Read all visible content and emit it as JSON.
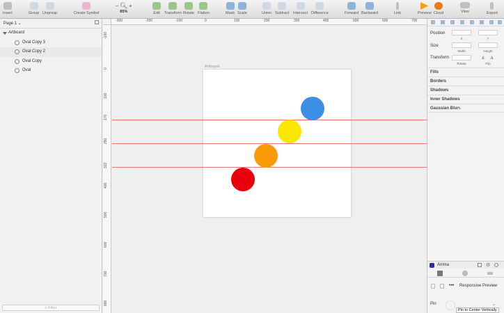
{
  "toolbar": {
    "insert": "Insert",
    "group": "Group",
    "ungroup": "Ungroup",
    "create_symbol": "Create Symbol",
    "zoom_minus": "–",
    "zoom_value": "85%",
    "zoom_plus": "+",
    "edit": "Edit",
    "transform": "Transform",
    "rotate": "Rotate",
    "flatten": "Flatten",
    "mask": "Mask",
    "scale": "Scale",
    "union": "Union",
    "subtract": "Subtract",
    "intersect": "Intersect",
    "difference": "Difference",
    "forward": "Forward",
    "backward": "Backward",
    "link": "Link",
    "preview": "Preview",
    "cloud": "Cloud",
    "view": "View",
    "export": "Export"
  },
  "left_panel": {
    "page": "Page 1",
    "layers": [
      {
        "name": "Artboard"
      },
      {
        "name": "Oval Copy 3"
      },
      {
        "name": "Oval Copy 2"
      },
      {
        "name": "Oval Copy"
      },
      {
        "name": "Oval"
      }
    ],
    "filter_placeholder": "Filter"
  },
  "ruler_h": [
    "-300",
    "-200",
    "-100",
    "0",
    "100",
    "200",
    "300",
    "400",
    "500",
    "600",
    "700"
  ],
  "ruler_v": [
    "-100",
    "0",
    "100",
    "170",
    "250",
    "332",
    "400",
    "500",
    "600",
    "700",
    "800"
  ],
  "canvas": {
    "artboard_title": "Artboard",
    "colors": {
      "blue": "#3d8fe6",
      "yellow": "#fbe800",
      "orange": "#fb9a07",
      "red": "#e8000b",
      "guide": "#e87474"
    }
  },
  "inspector": {
    "position": "Position",
    "x": "X",
    "y": "Y",
    "size": "Size",
    "width": "Width",
    "height": "Height",
    "transform": "Transform",
    "rotate": "Rotate",
    "flip": "Flip",
    "fills": "Fills",
    "borders": "Borders",
    "shadows": "Shadows",
    "inner_shadows": "Inner Shadows",
    "gaussian_blur": "Gaussian Blur"
  },
  "anima": {
    "name": "Anima",
    "responsive_preview": "Responsive Preview",
    "pin": "Pin",
    "pin_tooltip": "Pin to Center Vertically"
  }
}
